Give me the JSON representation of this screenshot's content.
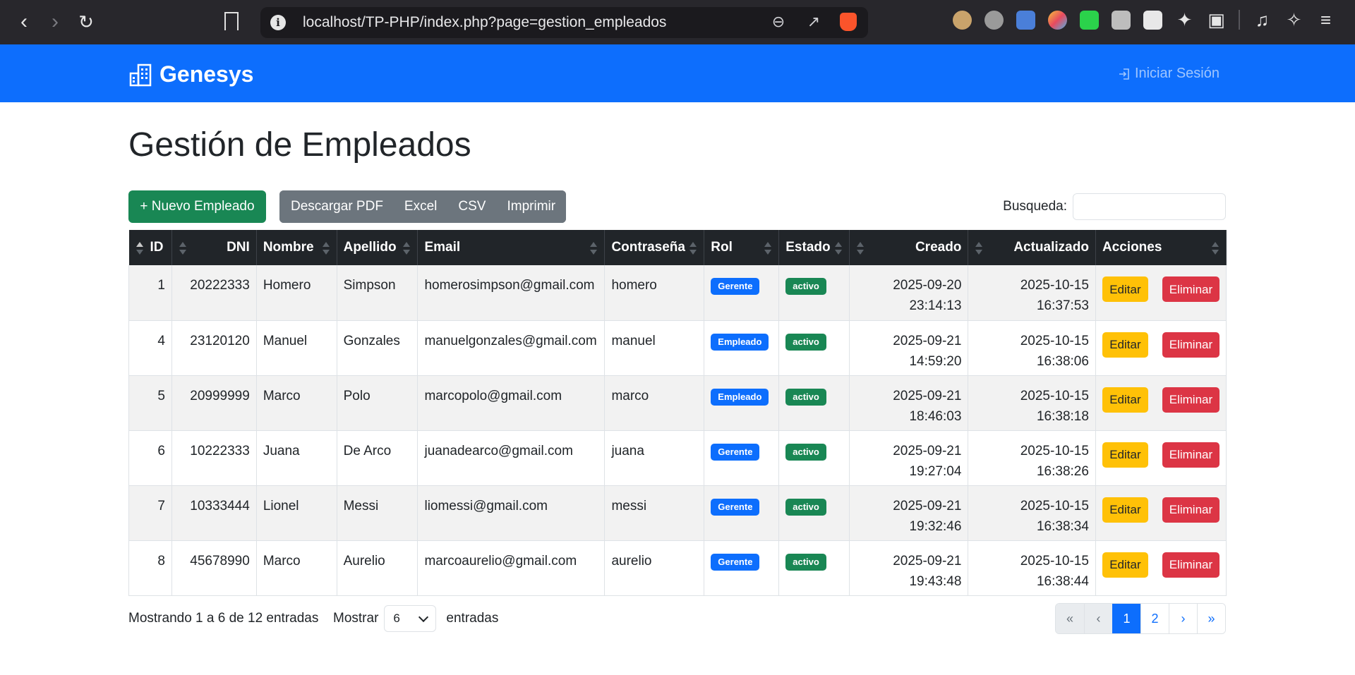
{
  "browser": {
    "url": "localhost/TP-PHP/index.php?page=gestion_empleados"
  },
  "navbar": {
    "brand": "Genesys",
    "login": "Iniciar Sesión"
  },
  "page": {
    "title": "Gestión de Empleados"
  },
  "toolbar": {
    "new_employee": "+ Nuevo Empleado",
    "export_buttons": [
      "Descargar PDF",
      "Excel",
      "CSV",
      "Imprimir"
    ],
    "search_label": "Busqueda:",
    "search_value": ""
  },
  "table": {
    "headers": [
      "ID",
      "DNI",
      "Nombre",
      "Apellido",
      "Email",
      "Contraseña",
      "Rol",
      "Estado",
      "Creado",
      "Actualizado",
      "Acciones"
    ],
    "rows": [
      {
        "id": "1",
        "dni": "20222333",
        "nombre": "Homero",
        "apellido": "Simpson",
        "email": "homerosimpson@gmail.com",
        "password": "homero",
        "rol": "Gerente",
        "estado": "activo",
        "creado_fecha": "2025-09-20",
        "creado_hora": "23:14:13",
        "act_fecha": "2025-10-15",
        "act_hora": "16:37:53"
      },
      {
        "id": "4",
        "dni": "23120120",
        "nombre": "Manuel",
        "apellido": "Gonzales",
        "email": "manuelgonzales@gmail.com",
        "password": "manuel",
        "rol": "Empleado",
        "estado": "activo",
        "creado_fecha": "2025-09-21",
        "creado_hora": "14:59:20",
        "act_fecha": "2025-10-15",
        "act_hora": "16:38:06"
      },
      {
        "id": "5",
        "dni": "20999999",
        "nombre": "Marco",
        "apellido": "Polo",
        "email": "marcopolo@gmail.com",
        "password": "marco",
        "rol": "Empleado",
        "estado": "activo",
        "creado_fecha": "2025-09-21",
        "creado_hora": "18:46:03",
        "act_fecha": "2025-10-15",
        "act_hora": "16:38:18"
      },
      {
        "id": "6",
        "dni": "10222333",
        "nombre": "Juana",
        "apellido": "De Arco",
        "email": "juanadearco@gmail.com",
        "password": "juana",
        "rol": "Gerente",
        "estado": "activo",
        "creado_fecha": "2025-09-21",
        "creado_hora": "19:27:04",
        "act_fecha": "2025-10-15",
        "act_hora": "16:38:26"
      },
      {
        "id": "7",
        "dni": "10333444",
        "nombre": "Lionel",
        "apellido": "Messi",
        "email": "liomessi@gmail.com",
        "password": "messi",
        "rol": "Gerente",
        "estado": "activo",
        "creado_fecha": "2025-09-21",
        "creado_hora": "19:32:46",
        "act_fecha": "2025-10-15",
        "act_hora": "16:38:34"
      },
      {
        "id": "8",
        "dni": "45678990",
        "nombre": "Marco",
        "apellido": "Aurelio",
        "email": "marcoaurelio@gmail.com",
        "password": "aurelio",
        "rol": "Gerente",
        "estado": "activo",
        "creado_fecha": "2025-09-21",
        "creado_hora": "19:43:48",
        "act_fecha": "2025-10-15",
        "act_hora": "16:38:44"
      }
    ],
    "edit_label": "Editar",
    "delete_label": "Eliminar"
  },
  "footer": {
    "info": "Mostrando 1 a 6 de 12 entradas",
    "show_label": "Mostrar",
    "page_size": "6",
    "entries_label": "entradas",
    "pagination": [
      "«",
      "‹",
      "1",
      "2",
      "›",
      "»"
    ],
    "current_page": "1"
  },
  "colors": {
    "primary": "#0d6efd",
    "success": "#198754",
    "secondary": "#6c757d",
    "warning": "#ffc107",
    "danger": "#dc3545",
    "dark": "#212529"
  }
}
